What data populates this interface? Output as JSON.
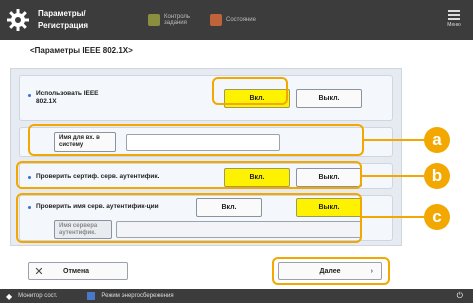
{
  "header": {
    "title": "Параметры/ Регистрация",
    "btn1_label": "Контроль задания",
    "btn2_label": "Состояние",
    "menu_label": "Меню"
  },
  "subtitle": "<Параметры IEEE 802.1X>",
  "use_ieee": {
    "label": "Использовать IEEE 802.1X",
    "on_label": "Вкл.",
    "off_label": "Выкл.",
    "selected": "on"
  },
  "login": {
    "label": "Имя для вх. в систему",
    "value": ""
  },
  "verify_server_cert": {
    "label": "Проверить сертиф. серв. аутентифик.",
    "on_label": "Вкл.",
    "off_label": "Выкл.",
    "selected": "on"
  },
  "verify_server_name": {
    "label": "Проверить имя серв. аутентифик-ции",
    "on_label": "Вкл.",
    "off_label": "Выкл.",
    "selected": "off",
    "server_name_label": "Имя сервера аутентифик.",
    "server_name_value": ""
  },
  "callouts": [
    "a",
    "b",
    "c"
  ],
  "bottom": {
    "cancel_label": "Отмена",
    "next_label": "Далее"
  },
  "footer": {
    "left_label": "Монитор сост.",
    "right_label": "Режим энергосбережения"
  },
  "colors": {
    "header_bg": "#3c3c3c",
    "panel_bg": "#e6ebf2",
    "selected_bg": "#fff200",
    "callout": "#f2a800",
    "bullet": "#3b6fd6"
  }
}
